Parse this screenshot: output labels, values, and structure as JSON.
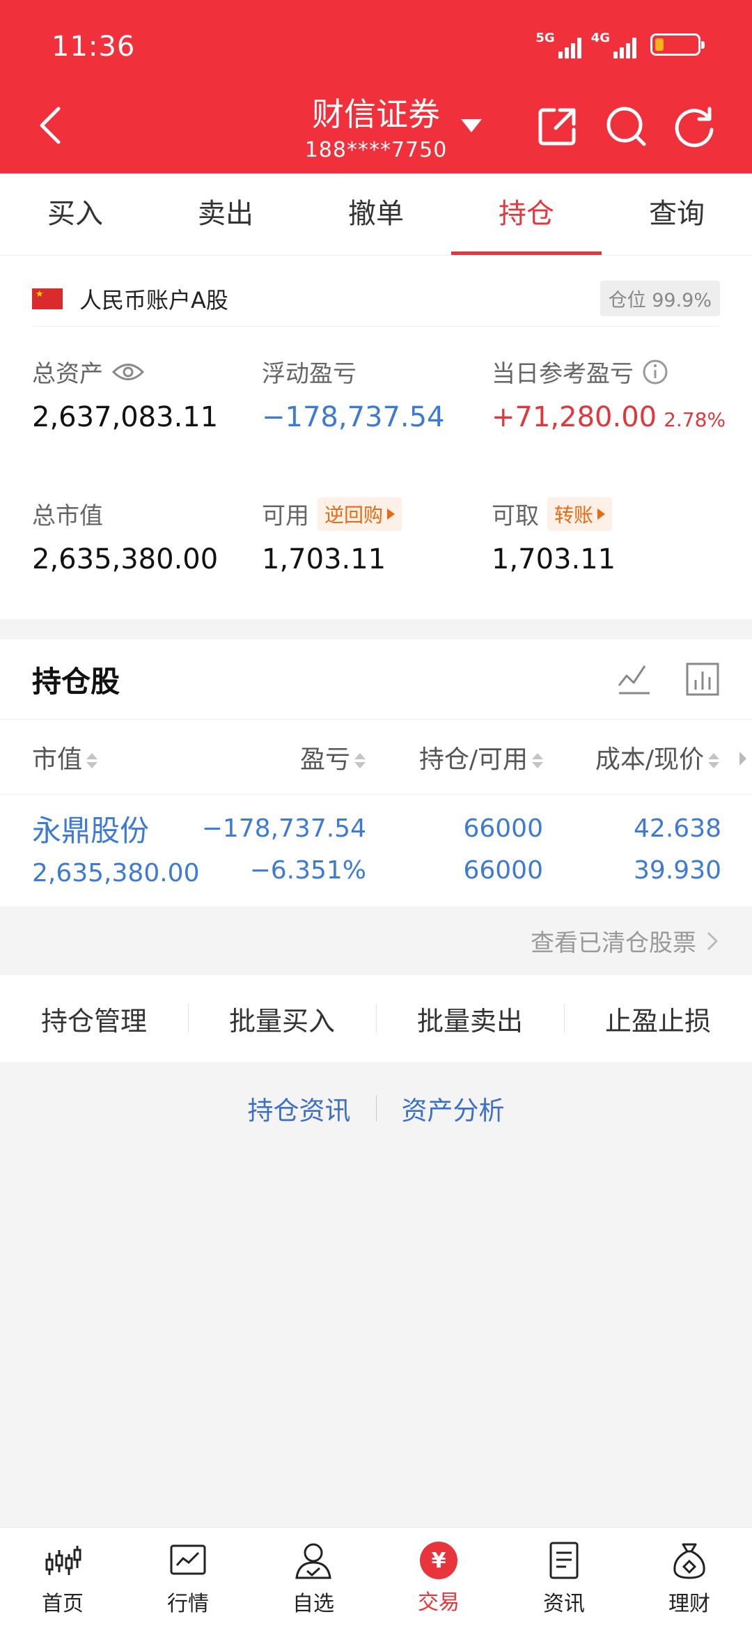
{
  "status_bar": {
    "time": "11:36",
    "net1": "5G",
    "net2": "4G"
  },
  "header": {
    "title": "财信证券",
    "account": "188****7750"
  },
  "tabs": [
    {
      "label": "买入"
    },
    {
      "label": "卖出"
    },
    {
      "label": "撤单"
    },
    {
      "label": "持仓",
      "active": true
    },
    {
      "label": "查询"
    }
  ],
  "account": {
    "name": "人民币账户A股",
    "position_badge": "仓位 99.9%",
    "total_assets_label": "总资产",
    "total_assets": "2,637,083.11",
    "floating_pl_label": "浮动盈亏",
    "floating_pl": "−178,737.54",
    "daily_pl_label": "当日参考盈亏",
    "daily_pl": "+71,280.00",
    "daily_pl_pct": "2.78%",
    "market_value_label": "总市值",
    "market_value": "2,635,380.00",
    "available_label": "可用",
    "reverse_repo_label": "逆回购",
    "available": "1,703.11",
    "withdrawable_label": "可取",
    "transfer_label": "转账",
    "withdrawable": "1,703.11"
  },
  "holdings": {
    "title": "持仓股",
    "columns": [
      "市值",
      "盈亏",
      "持仓/可用",
      "成本/现价"
    ],
    "rows": [
      {
        "name": "永鼎股份",
        "market_value": "2,635,380.00",
        "pl": "−178,737.54",
        "pl_pct": "−6.351%",
        "position": "66000",
        "available": "66000",
        "cost": "42.638",
        "price": "39.930"
      }
    ],
    "cleared_link": "查看已清仓股票"
  },
  "actions": [
    "持仓管理",
    "批量买入",
    "批量卖出",
    "止盈止损"
  ],
  "links": [
    "持仓资讯",
    "资产分析"
  ],
  "bottom_nav": [
    {
      "label": "首页",
      "icon": "home-chart-icon"
    },
    {
      "label": "行情",
      "icon": "market-icon"
    },
    {
      "label": "自选",
      "icon": "watchlist-user-icon"
    },
    {
      "label": "交易",
      "icon": "trade-yen-icon",
      "glyph": "¥",
      "active": true
    },
    {
      "label": "资讯",
      "icon": "news-doc-icon"
    },
    {
      "label": "理财",
      "icon": "wealth-bag-icon"
    }
  ],
  "colors": {
    "brand_red": "#f0303a",
    "link_blue": "#3d7ad6",
    "gain_red": "#e0373d",
    "tag_orange": "#e86a12"
  }
}
